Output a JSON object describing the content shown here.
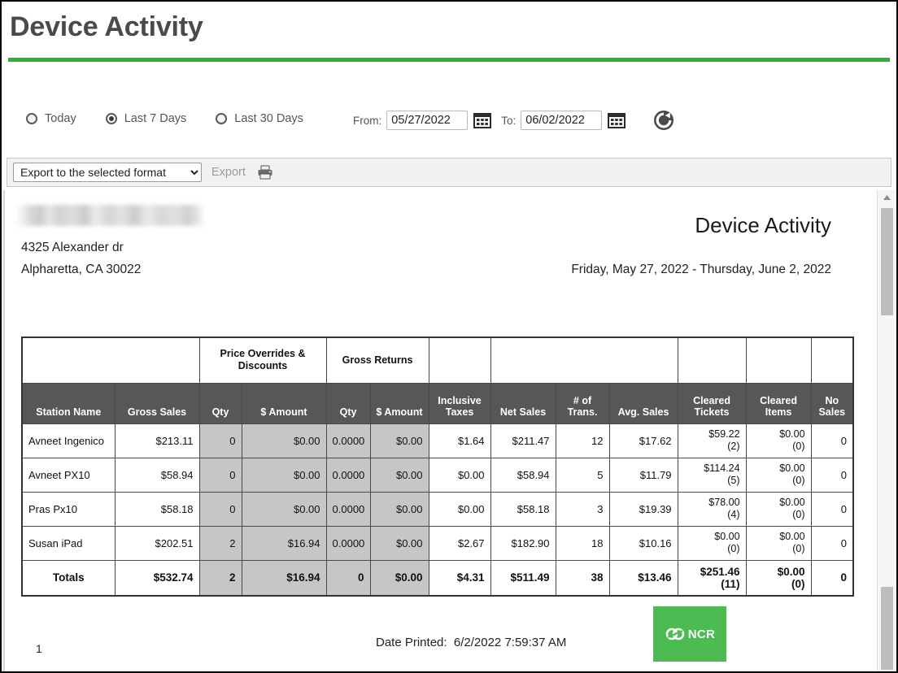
{
  "page": {
    "title": "Device Activity",
    "accent_green": "#2bb13a"
  },
  "filters": {
    "radios": [
      {
        "label": "Today",
        "selected": false
      },
      {
        "label": "Last 7 Days",
        "selected": true
      },
      {
        "label": "Last 30 Days",
        "selected": false
      }
    ],
    "from_label": "From:",
    "from_value": "05/27/2022",
    "to_label": "To:",
    "to_value": "06/02/2022",
    "calendar_icon": "calendar-icon",
    "refresh_icon": "refresh-icon"
  },
  "toolbar": {
    "export_select_value": "Export to the selected format",
    "export_link": "Export",
    "print_icon": "printer-icon"
  },
  "report": {
    "store_name": "",
    "address_line1": "4325 Alexander dr",
    "address_line2": "Alpharetta, CA 30022",
    "title": "Device Activity",
    "date_range": "Friday, May 27, 2022 - Thursday, June 2, 2022",
    "page_number": "1",
    "date_printed_label": "Date Printed:",
    "date_printed_value": "6/2/2022 7:59:37 AM",
    "logo_text": "NCR"
  },
  "table": {
    "group_headers": [
      {
        "label": "",
        "span": 2,
        "dark": false
      },
      {
        "label": "Price Overrides & Discounts",
        "span": 2,
        "dark": true
      },
      {
        "label": "Gross Returns",
        "span": 2,
        "dark": true
      },
      {
        "label": "",
        "span": 1,
        "dark": false
      },
      {
        "label": "",
        "span": 3,
        "dark": false
      },
      {
        "label": "",
        "span": 1,
        "dark": false
      },
      {
        "label": "",
        "span": 1,
        "dark": false
      },
      {
        "label": "",
        "span": 1,
        "dark": false
      }
    ],
    "columns": [
      "Station Name",
      "Gross Sales",
      "Qty",
      "$ Amount",
      "Qty",
      "$ Amount",
      "Inclusive Taxes",
      "Net Sales",
      "# of Trans.",
      "Avg. Sales",
      "Cleared Tickets",
      "Cleared Items",
      "No Sales"
    ],
    "rows": [
      {
        "station": "Avneet Ingenico",
        "gross_sales": "$213.11",
        "po_qty": "0",
        "po_amount": "$0.00",
        "gr_qty": "0.0000",
        "gr_amount": "$0.00",
        "inclusive_taxes": "$1.64",
        "net_sales": "$211.47",
        "num_trans": "12",
        "avg_sales": "$17.62",
        "cleared_tickets": "$59.22",
        "cleared_tickets_count": "(2)",
        "cleared_items": "$0.00",
        "cleared_items_count": "(0)",
        "no_sales": "0"
      },
      {
        "station": "Avneet PX10",
        "gross_sales": "$58.94",
        "po_qty": "0",
        "po_amount": "$0.00",
        "gr_qty": "0.0000",
        "gr_amount": "$0.00",
        "inclusive_taxes": "$0.00",
        "net_sales": "$58.94",
        "num_trans": "5",
        "avg_sales": "$11.79",
        "cleared_tickets": "$114.24",
        "cleared_tickets_count": "(5)",
        "cleared_items": "$0.00",
        "cleared_items_count": "(0)",
        "no_sales": "0"
      },
      {
        "station": "Pras Px10",
        "gross_sales": "$58.18",
        "po_qty": "0",
        "po_amount": "$0.00",
        "gr_qty": "0.0000",
        "gr_amount": "$0.00",
        "inclusive_taxes": "$0.00",
        "net_sales": "$58.18",
        "num_trans": "3",
        "avg_sales": "$19.39",
        "cleared_tickets": "$78.00",
        "cleared_tickets_count": "(4)",
        "cleared_items": "$0.00",
        "cleared_items_count": "(0)",
        "no_sales": "0"
      },
      {
        "station": "Susan iPad",
        "gross_sales": "$202.51",
        "po_qty": "2",
        "po_amount": "$16.94",
        "gr_qty": "0.0000",
        "gr_amount": "$0.00",
        "inclusive_taxes": "$2.67",
        "net_sales": "$182.90",
        "num_trans": "18",
        "avg_sales": "$10.16",
        "cleared_tickets": "$0.00",
        "cleared_tickets_count": "(0)",
        "cleared_items": "$0.00",
        "cleared_items_count": "(0)",
        "no_sales": "0"
      }
    ],
    "totals": {
      "station": "Totals",
      "gross_sales": "$532.74",
      "po_qty": "2",
      "po_amount": "$16.94",
      "gr_qty": "0",
      "gr_amount": "$0.00",
      "inclusive_taxes": "$4.31",
      "net_sales": "$511.49",
      "num_trans": "38",
      "avg_sales": "$13.46",
      "cleared_tickets": "$251.46",
      "cleared_tickets_count": "(11)",
      "cleared_items": "$0.00",
      "cleared_items_count": "(0)",
      "no_sales": "0"
    }
  }
}
